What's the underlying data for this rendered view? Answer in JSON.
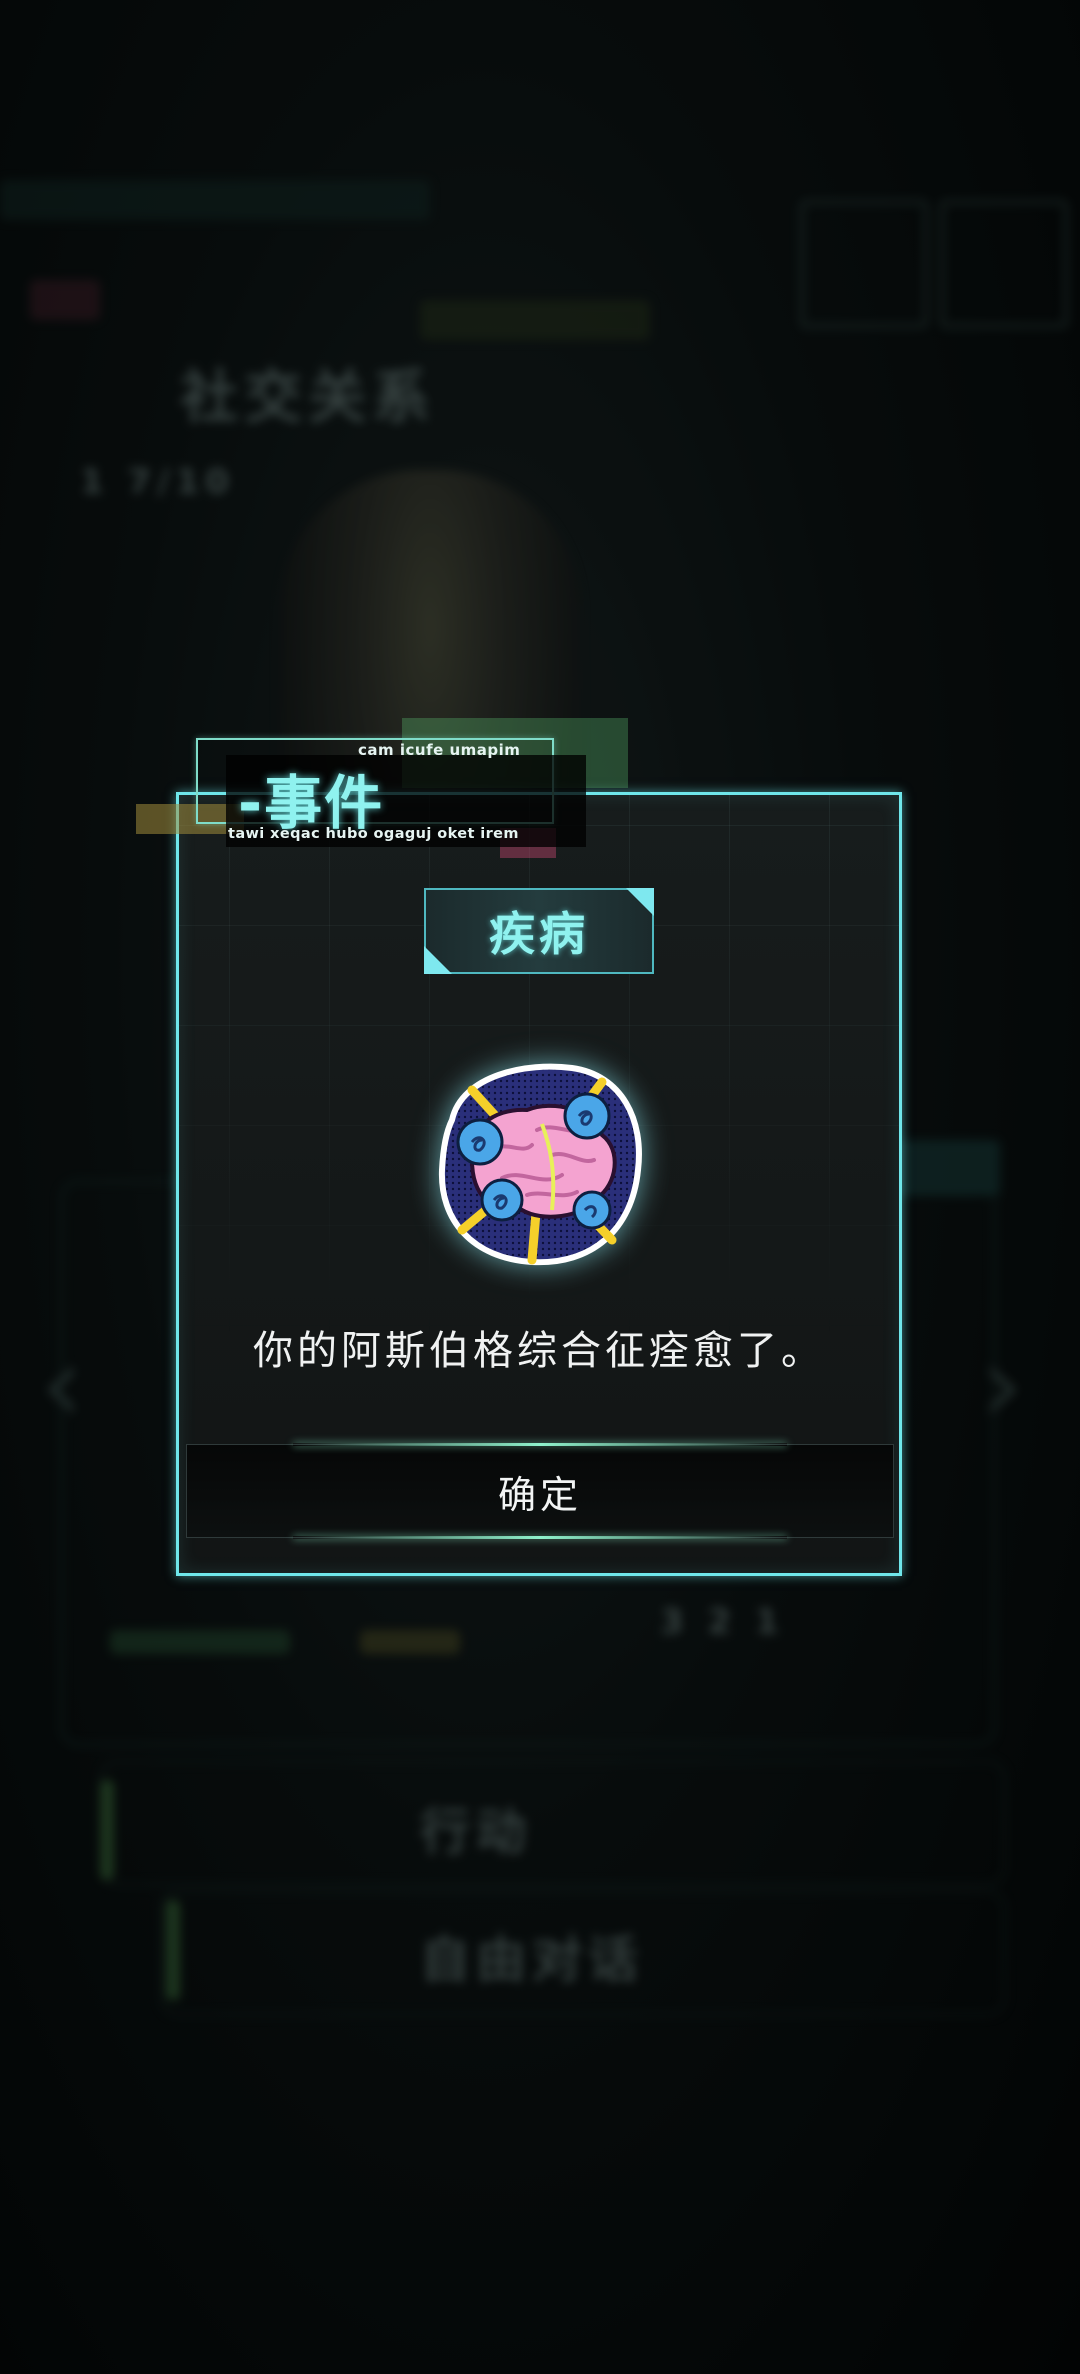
{
  "background": {
    "hud_title": "社交关系",
    "hud_label_small": "1 7/10",
    "hud_row_action": "行动",
    "hud_row_talk": "自由对话",
    "hud_counter": "3 2 1"
  },
  "dialog": {
    "header": {
      "title": "-事件",
      "top_caption": "cam icufe umapim",
      "bottom_caption": "tawi xeqac hubo ogaguj oket irem"
    },
    "tag": {
      "label": "疾病"
    },
    "icon": "brain-with-roses-icon",
    "message": "你的阿斯伯格综合征痊愈了。",
    "confirm_label": "确定"
  },
  "colors": {
    "accent": "#6fe6ea",
    "tag_text": "#8ff2ef",
    "dialog_bg": "#151919",
    "button_glow": "#8ff2cc"
  }
}
